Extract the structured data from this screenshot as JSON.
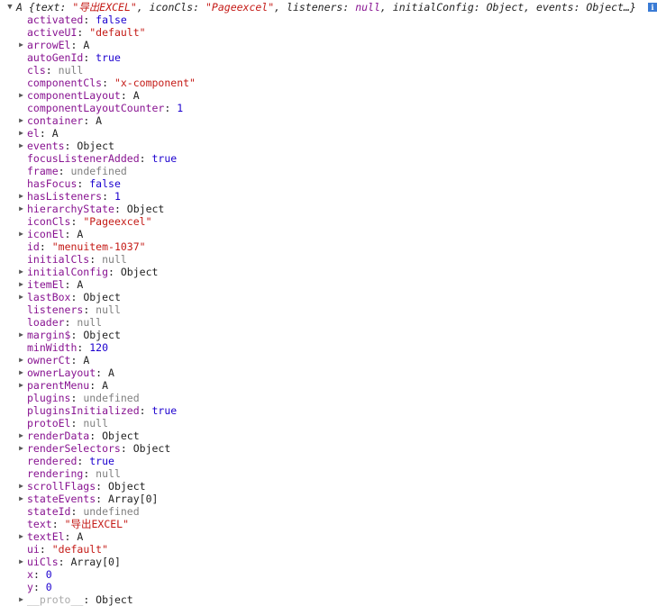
{
  "header": {
    "toggle": "▼",
    "summary_parts": [
      {
        "t": "A {",
        "c": "plain"
      },
      {
        "t": "text",
        "c": "key"
      },
      {
        "t": ": ",
        "c": "plain"
      },
      {
        "t": "\"导出EXCEL\"",
        "c": "str"
      },
      {
        "t": ", ",
        "c": "plain"
      },
      {
        "t": "iconCls",
        "c": "key"
      },
      {
        "t": ": ",
        "c": "plain"
      },
      {
        "t": "\"Pageexcel\"",
        "c": "str"
      },
      {
        "t": ", ",
        "c": "plain"
      },
      {
        "t": "listeners",
        "c": "key"
      },
      {
        "t": ": ",
        "c": "plain"
      },
      {
        "t": "null",
        "c": "kw"
      },
      {
        "t": ", ",
        "c": "plain"
      },
      {
        "t": "initialConfig",
        "c": "key"
      },
      {
        "t": ": Object, ",
        "c": "plain"
      },
      {
        "t": "events",
        "c": "key"
      },
      {
        "t": ": Object…}",
        "c": "plain"
      }
    ],
    "info_icon": "i"
  },
  "properties": [
    {
      "key": "activated",
      "value": "false",
      "type": "kw",
      "expandable": false
    },
    {
      "key": "activeUI",
      "value": "\"default\"",
      "type": "str",
      "expandable": false
    },
    {
      "key": "arrowEl",
      "value": "A",
      "type": "obj",
      "expandable": true
    },
    {
      "key": "autoGenId",
      "value": "true",
      "type": "kw",
      "expandable": false
    },
    {
      "key": "cls",
      "value": "null",
      "type": "null",
      "expandable": false
    },
    {
      "key": "componentCls",
      "value": "\"x-component\"",
      "type": "str",
      "expandable": false
    },
    {
      "key": "componentLayout",
      "value": "A",
      "type": "obj",
      "expandable": true
    },
    {
      "key": "componentLayoutCounter",
      "value": "1",
      "type": "num",
      "expandable": false
    },
    {
      "key": "container",
      "value": "A",
      "type": "obj",
      "expandable": true
    },
    {
      "key": "el",
      "value": "A",
      "type": "obj",
      "expandable": true
    },
    {
      "key": "events",
      "value": "Object",
      "type": "obj",
      "expandable": true
    },
    {
      "key": "focusListenerAdded",
      "value": "true",
      "type": "kw",
      "expandable": false
    },
    {
      "key": "frame",
      "value": "undefined",
      "type": "null",
      "expandable": false
    },
    {
      "key": "hasFocus",
      "value": "false",
      "type": "kw",
      "expandable": false
    },
    {
      "key": "hasListeners",
      "value": "1",
      "type": "num",
      "expandable": true
    },
    {
      "key": "hierarchyState",
      "value": "Object",
      "type": "obj",
      "expandable": true
    },
    {
      "key": "iconCls",
      "value": "\"Pageexcel\"",
      "type": "str",
      "expandable": false
    },
    {
      "key": "iconEl",
      "value": "A",
      "type": "obj",
      "expandable": true
    },
    {
      "key": "id",
      "value": "\"menuitem-1037\"",
      "type": "str",
      "expandable": false
    },
    {
      "key": "initialCls",
      "value": "null",
      "type": "null",
      "expandable": false
    },
    {
      "key": "initialConfig",
      "value": "Object",
      "type": "obj",
      "expandable": true
    },
    {
      "key": "itemEl",
      "value": "A",
      "type": "obj",
      "expandable": true
    },
    {
      "key": "lastBox",
      "value": "Object",
      "type": "obj",
      "expandable": true
    },
    {
      "key": "listeners",
      "value": "null",
      "type": "null",
      "expandable": false
    },
    {
      "key": "loader",
      "value": "null",
      "type": "null",
      "expandable": false
    },
    {
      "key": "margin$",
      "value": "Object",
      "type": "obj",
      "expandable": true
    },
    {
      "key": "minWidth",
      "value": "120",
      "type": "num",
      "expandable": false
    },
    {
      "key": "ownerCt",
      "value": "A",
      "type": "obj",
      "expandable": true
    },
    {
      "key": "ownerLayout",
      "value": "A",
      "type": "obj",
      "expandable": true
    },
    {
      "key": "parentMenu",
      "value": "A",
      "type": "obj",
      "expandable": true
    },
    {
      "key": "plugins",
      "value": "undefined",
      "type": "null",
      "expandable": false
    },
    {
      "key": "pluginsInitialized",
      "value": "true",
      "type": "kw",
      "expandable": false
    },
    {
      "key": "protoEl",
      "value": "null",
      "type": "null",
      "expandable": false
    },
    {
      "key": "renderData",
      "value": "Object",
      "type": "obj",
      "expandable": true
    },
    {
      "key": "renderSelectors",
      "value": "Object",
      "type": "obj",
      "expandable": true
    },
    {
      "key": "rendered",
      "value": "true",
      "type": "kw",
      "expandable": false
    },
    {
      "key": "rendering",
      "value": "null",
      "type": "null",
      "expandable": false
    },
    {
      "key": "scrollFlags",
      "value": "Object",
      "type": "obj",
      "expandable": true
    },
    {
      "key": "stateEvents",
      "value": "Array[0]",
      "type": "obj",
      "expandable": true
    },
    {
      "key": "stateId",
      "value": "undefined",
      "type": "null",
      "expandable": false
    },
    {
      "key": "text",
      "value": "\"导出EXCEL\"",
      "type": "str",
      "expandable": false
    },
    {
      "key": "textEl",
      "value": "A",
      "type": "obj",
      "expandable": true
    },
    {
      "key": "ui",
      "value": "\"default\"",
      "type": "str",
      "expandable": false
    },
    {
      "key": "uiCls",
      "value": "Array[0]",
      "type": "obj",
      "expandable": true
    },
    {
      "key": "x",
      "value": "0",
      "type": "num",
      "expandable": false
    },
    {
      "key": "y",
      "value": "0",
      "type": "num",
      "expandable": false
    },
    {
      "key": "__proto__",
      "value": "Object",
      "type": "obj",
      "expandable": true,
      "dim": true
    }
  ]
}
